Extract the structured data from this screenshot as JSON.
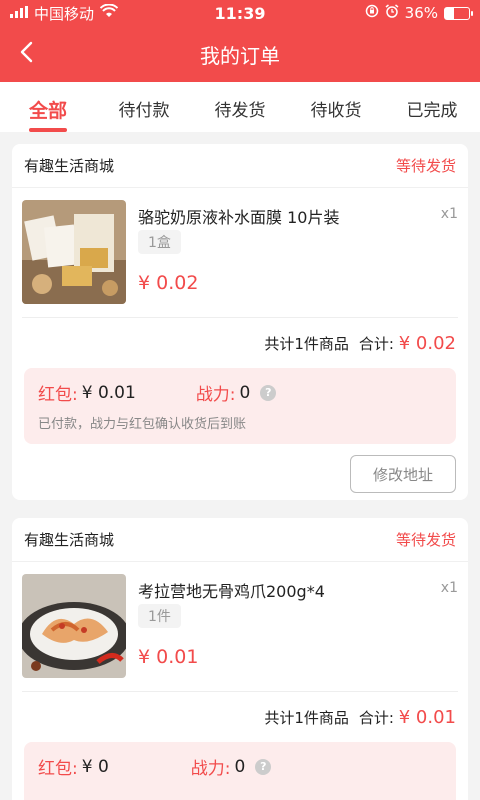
{
  "status_bar": {
    "carrier": "中国移动",
    "time": "11:39",
    "battery": "36%",
    "battery_level": 0.36,
    "icons": [
      "signal-icon",
      "wifi-icon",
      "rotation-lock-icon",
      "alarm-icon",
      "battery-icon"
    ]
  },
  "nav": {
    "title": "我的订单",
    "back_icon": "chevron-left-icon"
  },
  "tabs": [
    {
      "label": "全部",
      "active": true
    },
    {
      "label": "待付款",
      "active": false
    },
    {
      "label": "待发货",
      "active": false
    },
    {
      "label": "待收货",
      "active": false
    },
    {
      "label": "已完成",
      "active": false
    }
  ],
  "orders": [
    {
      "shop": "有趣生活商城",
      "status": "等待发货",
      "product": {
        "title": "骆驼奶原液补水面膜 10片装",
        "spec": "1盒",
        "qty": "x1",
        "price": "¥ 0.02"
      },
      "summary": {
        "count_text": "共计1件商品",
        "total_label": "合计:",
        "total": "¥ 0.02"
      },
      "reward": {
        "hongbao_label": "红包:",
        "hongbao_value": "¥ 0.01",
        "power_label": "战力:",
        "power_value": "0",
        "note": "已付款，战力与红包确认收货后到账"
      },
      "action_label": "修改地址"
    },
    {
      "shop": "有趣生活商城",
      "status": "等待发货",
      "product": {
        "title": "考拉营地无骨鸡爪200g*4",
        "spec": "1件",
        "qty": "x1",
        "price": "¥ 0.01"
      },
      "summary": {
        "count_text": "共计1件商品",
        "total_label": "合计:",
        "total": "¥ 0.01"
      },
      "reward": {
        "hongbao_label": "红包:",
        "hongbao_value": "¥ 0",
        "power_label": "战力:",
        "power_value": "0"
      }
    }
  ],
  "colors": {
    "brand": "#f24b4b",
    "background": "#f3f3f3",
    "reward_bg": "#fdecec"
  }
}
